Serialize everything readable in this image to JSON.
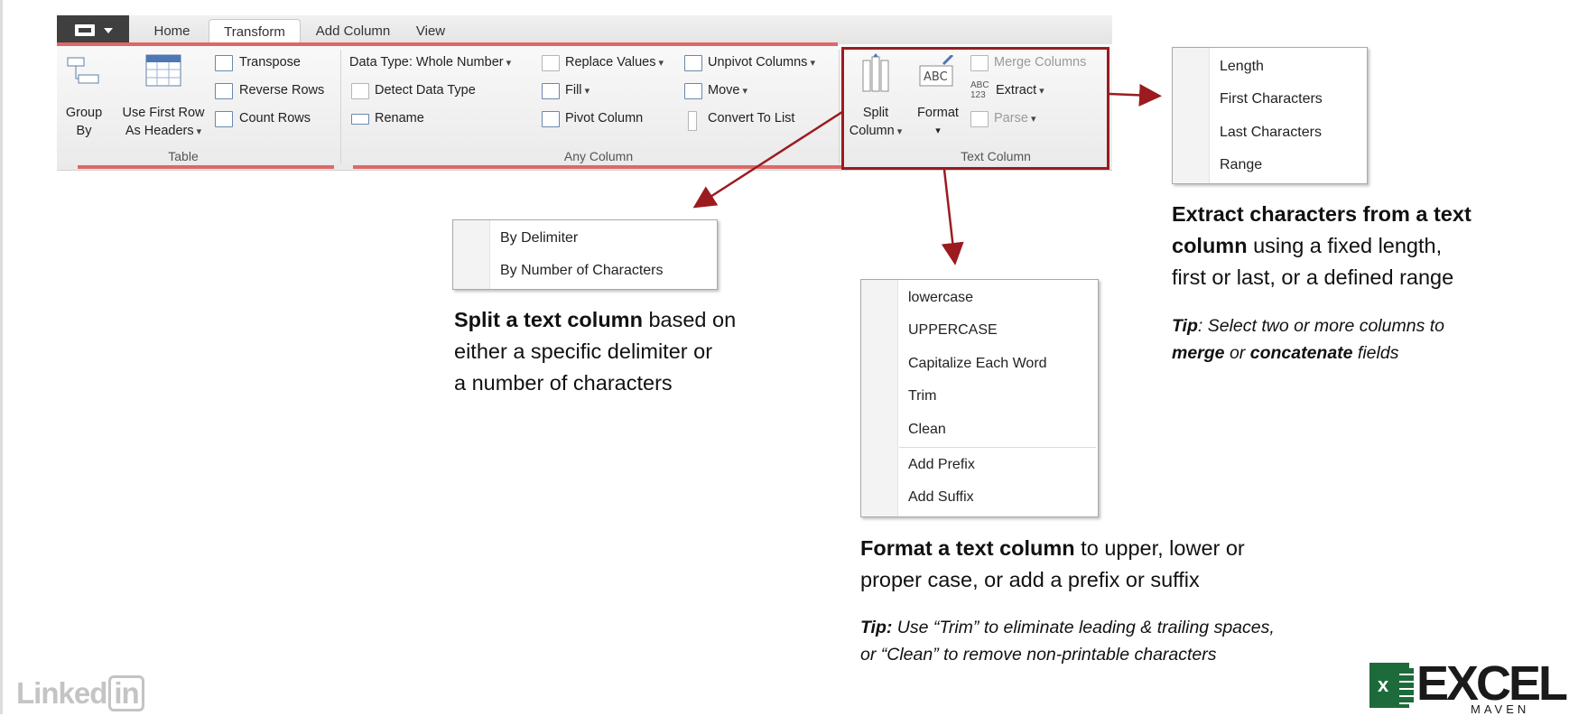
{
  "ribbon": {
    "tabs": [
      "Home",
      "Transform",
      "Add Column",
      "View"
    ],
    "active_tab": "Transform",
    "groups": {
      "table": {
        "label": "Table",
        "group_by": [
          "Group",
          "By"
        ],
        "use_first_row": [
          "Use First Row",
          "As Headers"
        ],
        "transpose": "Transpose",
        "reverse_rows": "Reverse Rows",
        "count_rows": "Count Rows"
      },
      "any_column": {
        "label": "Any Column",
        "data_type": "Data Type: Whole Number",
        "detect_data_type": "Detect Data Type",
        "rename": "Rename",
        "replace_values": "Replace Values",
        "fill": "Fill",
        "pivot_column": "Pivot Column",
        "unpivot_columns": "Unpivot Columns",
        "move": "Move",
        "convert_to_list": "Convert To List"
      },
      "text_column": {
        "label": "Text Column",
        "split_column": [
          "Split",
          "Column"
        ],
        "format": "Format",
        "merge_columns": "Merge Columns",
        "extract": "Extract",
        "parse": "Parse"
      }
    }
  },
  "menus": {
    "extract": [
      "Length",
      "First Characters",
      "Last Characters",
      "Range"
    ],
    "split": [
      "By Delimiter",
      "By Number of Characters"
    ],
    "format_case": [
      "lowercase",
      "UPPERCASE",
      "Capitalize Each Word",
      "Trim",
      "Clean"
    ],
    "format_affix": [
      "Add Prefix",
      "Add Suffix"
    ]
  },
  "captions": {
    "extract": {
      "bold": "Extract characters from a text column",
      "rest_line1_bold": "Extract characters from a text",
      "line2_bold": "column",
      "line2_rest": " using a fixed length,",
      "line3": "first or last, or a defined range"
    },
    "extract_tip": {
      "tip_word": "Tip",
      "line1": ": Select two or more columns to",
      "merge": "merge",
      "or": " or ",
      "concatenate": "concatenate",
      "fields": " fields"
    },
    "split": {
      "bold": "Split a text column",
      "line1_rest": " based on",
      "line2": "either a specific delimiter or",
      "line3": "a number of characters"
    },
    "format": {
      "bold": "Format a text column",
      "line1_rest": " to upper, lower or",
      "line2": "proper case, or add a prefix or suffix"
    },
    "format_tip": {
      "tip_word": "Tip:",
      "line1": " Use “Trim” to eliminate leading & trailing spaces,",
      "line2": "or “Clean” to remove non-printable characters"
    }
  },
  "logos": {
    "linkedin_word": "Linked",
    "linkedin_in": "in",
    "excel_x": "x",
    "excel_word": "EXCEL",
    "excel_sub": "MAVEN"
  },
  "colors": {
    "callout_red": "#9b1b1f",
    "underline_red": "#e06767",
    "excel_green": "#1d6b3a"
  }
}
